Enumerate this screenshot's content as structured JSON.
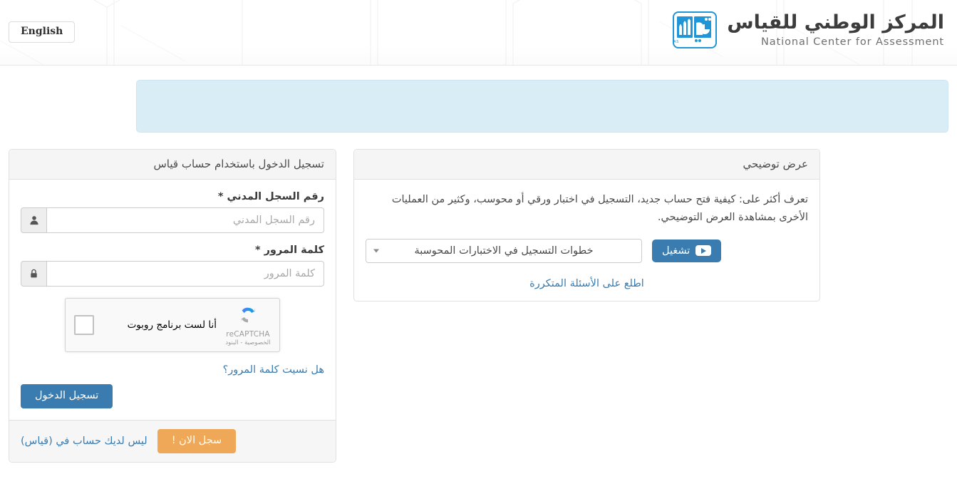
{
  "header": {
    "lang_toggle": "English",
    "brand_ar": "المركز الوطني للقياس",
    "brand_en": "National Center for Assessment",
    "logo_caption": "QIYAS"
  },
  "alert": {
    "message": ""
  },
  "login_panel": {
    "title": "تسجيل الدخول باستخدام حساب قياس",
    "id_label": "رقم السجل المدني *",
    "id_placeholder": "رقم السجل المدني",
    "id_value": "",
    "id_icon": "user-icon",
    "password_label": "كلمة المرور *",
    "password_placeholder": "كلمة المرور",
    "password_value": "",
    "password_icon": "lock-icon",
    "recaptcha": {
      "label": "أنا لست برنامج روبوت",
      "brand": "reCAPTCHA",
      "terms": "الخصوصية - البنود",
      "checked": false
    },
    "forgot_password": "هل نسيت كلمة المرور؟",
    "submit": "تسجيل الدخول",
    "footer_text": "ليس لديك حساب في (قياس)",
    "register_button": "سجل الان !"
  },
  "demo_panel": {
    "title": "عرض توضيحي",
    "description": "تعرف أكثر على: كيفية فتح حساب جديد، التسجيل في اختبار ورقي أو محوسب، وكثير من العمليات الأخرى بمشاهدة العرض التوضيحي.",
    "select_value": "خطوات التسجيل في الاختبارات المحوسبة",
    "play_button": "تشغيل",
    "faq_link": "اطلع على الأسئلة المتكررة"
  },
  "colors": {
    "primary_blue": "#3a7cb0",
    "logo_blue": "#2196d6",
    "orange": "#efa857",
    "alert_bg": "#d9edf7",
    "panel_head_bg": "#f5f5f5"
  }
}
